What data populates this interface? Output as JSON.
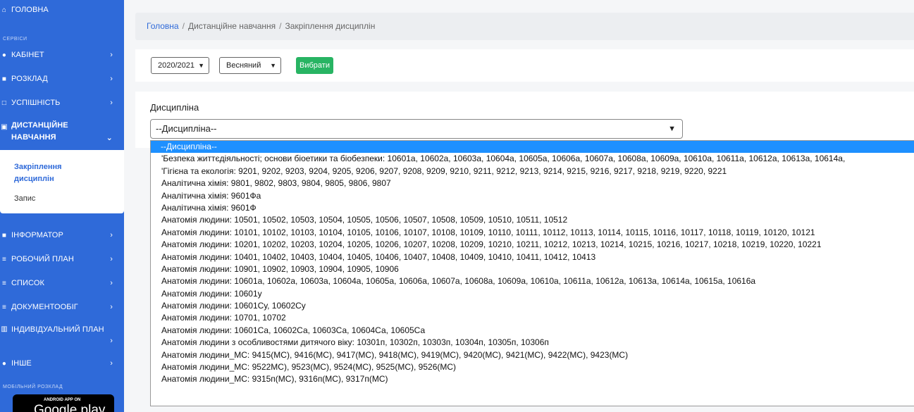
{
  "sidebar": {
    "home": "Головна",
    "services_label": "Сервіси",
    "items": [
      {
        "label": "Кабінет"
      },
      {
        "label": "Розклад"
      },
      {
        "label": "Успішність"
      },
      {
        "label": "Дистанційне навчання",
        "line1": "Дистанційне",
        "line2": "навчання"
      },
      {
        "label": "Інформатор"
      },
      {
        "label": "Робочий план"
      },
      {
        "label": "Список"
      },
      {
        "label": "Документообіг"
      },
      {
        "label": "Індивідуальний план"
      },
      {
        "label": "Інше"
      }
    ],
    "submenu": {
      "active": "Закріплення дисциплін",
      "other": "Запис"
    },
    "mobile_label": "Мобільний розклад",
    "gplay_small": "ANDROID APP ON",
    "gplay_big": "Google play"
  },
  "breadcrumb": {
    "home": "Головна",
    "section": "Дистанційне навчання",
    "current": "Закріплення дисциплін"
  },
  "filters": {
    "year": "2020/2021",
    "semester": "Весняний",
    "submit": "Вибрати"
  },
  "discipline": {
    "label": "Дисципліна",
    "selected": "--Дисципліна--",
    "options": [
      "--Дисципліна--",
      "'Безпека життєдіяльності; основи біоетики та біобезпеки: 10601а, 10602а, 10603а, 10604а, 10605а, 10606а, 10607а, 10608а, 10609а, 10610а, 10611а, 10612а, 10613а, 10614а,",
      "'Гігієна та екологія: 9201, 9202, 9203, 9204, 9205, 9206, 9207, 9208, 9209, 9210, 9211, 9212, 9213, 9214, 9215, 9216, 9217, 9218, 9219, 9220, 9221",
      "Аналітична хімія: 9801, 9802, 9803, 9804, 9805, 9806, 9807",
      "Аналітична хімія: 9601Фа",
      "Аналітична хімія: 9601Ф",
      "Анатомія людини: 10501, 10502, 10503, 10504, 10505, 10506, 10507, 10508, 10509, 10510, 10511, 10512",
      "Анатомія людини: 10101, 10102, 10103, 10104, 10105, 10106, 10107, 10108, 10109, 10110, 10111, 10112, 10113, 10114, 10115, 10116, 10117, 10118, 10119, 10120, 10121",
      "Анатомія людини: 10201, 10202, 10203, 10204, 10205, 10206, 10207, 10208, 10209, 10210, 10211, 10212, 10213, 10214, 10215, 10216, 10217, 10218, 10219, 10220, 10221",
      "Анатомія людини: 10401, 10402, 10403, 10404, 10405, 10406, 10407, 10408, 10409, 10410, 10411, 10412, 10413",
      "Анатомія людини: 10901, 10902, 10903, 10904, 10905, 10906",
      "Анатомія людини: 10601а, 10602а, 10603а, 10604а, 10605а, 10606а, 10607а, 10608а, 10609а, 10610а, 10611а, 10612а, 10613а, 10614а, 10615а, 10616а",
      "Анатомія людини: 10601у",
      "Анатомія людини: 10601Су, 10602Су",
      "Анатомія людини: 10701, 10702",
      "Анатомія людини: 10601Са, 10602Са, 10603Са, 10604Са, 10605Са",
      "Анатомія людини з особливостями дитячого віку: 10301п, 10302п, 10303п, 10304п, 10305п, 10306п",
      "Анатомія людини_МС: 9415(МС), 9416(МС), 9417(МС), 9418(МС), 9419(МС), 9420(МС), 9421(МС), 9422(МС), 9423(МС)",
      "Анатомія людини_МС: 9522МС), 9523(МС), 9524(МС), 9525(МС), 9526(МС)",
      "Анатомія людини_МС: 9315п(МС), 9316п(МС), 9317п(МС)"
    ]
  },
  "colors": {
    "sidebar": "#2f6ad9",
    "accent_green": "#28b463",
    "highlight": "#1e90ff"
  }
}
